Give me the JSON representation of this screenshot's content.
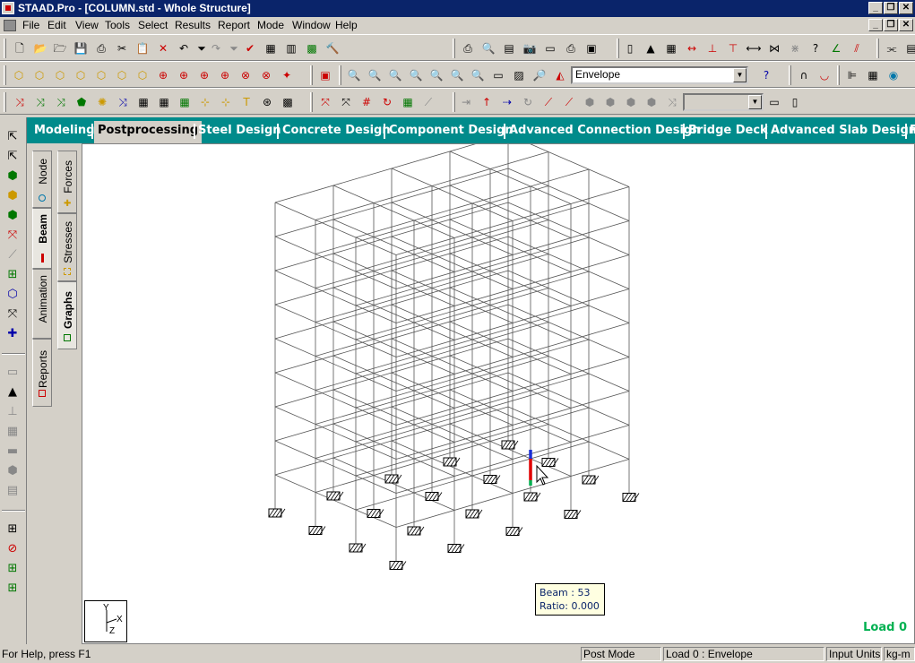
{
  "window": {
    "title": "STAAD.Pro - [COLUMN.std - Whole Structure]",
    "controls": [
      "_",
      "❐",
      "✕"
    ]
  },
  "menu": [
    "File",
    "Edit",
    "View",
    "Tools",
    "Select",
    "Results",
    "Report",
    "Mode",
    "Window",
    "Help"
  ],
  "toolbar": {
    "load_case_combo": "Envelope",
    "disabled_combo": ""
  },
  "page_tabs": [
    "Modeling",
    "Postprocessing",
    "Steel Design",
    "Concrete Design",
    "Component Design",
    "Advanced Connection Design",
    "Bridge Deck",
    "Advanced Slab Design",
    "P"
  ],
  "active_page_tab": "Postprocessing",
  "side_tabs": {
    "outer": [
      "Node",
      "Beam",
      "Animation",
      "Reports"
    ],
    "inner": [
      "Forces",
      "Stresses",
      "Graphs"
    ],
    "active_outer": "Beam",
    "active_inner": "Graphs"
  },
  "viewport": {
    "tooltip": {
      "beam": "Beam : 53",
      "ratio": "Ratio: 0.000"
    },
    "load_label": "Load 0",
    "axis_labels": {
      "y": "Y",
      "x": "X",
      "z": "Z"
    }
  },
  "status": {
    "help": "For Help, press F1",
    "mode": "Post Mode",
    "load": "Load 0 : Envelope",
    "units_label": "Input Units:",
    "units": "kg-m"
  }
}
